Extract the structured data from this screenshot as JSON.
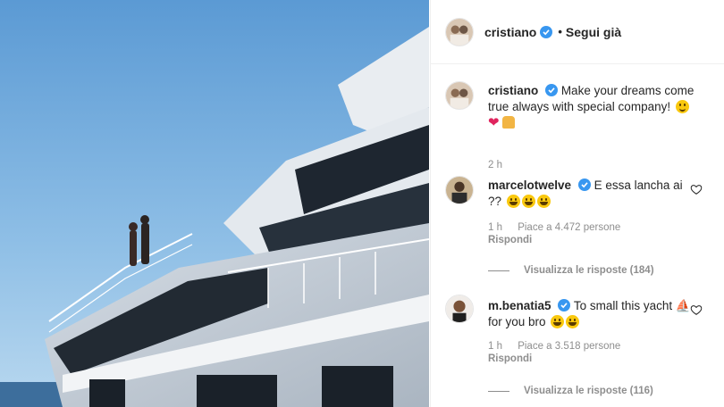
{
  "post": {
    "author": "cristiano",
    "follow_status": "Segui già",
    "separator": "•"
  },
  "caption": {
    "user": "cristiano",
    "text": "Make your dreams come true always with special company!",
    "time": "2 h"
  },
  "comments": [
    {
      "user": "marcelotwelve",
      "text": "E essa lancha ai ??",
      "time": "1 h",
      "likes": "Piace a 4.472 persone",
      "reply": "Rispondi",
      "view_replies": "Visualizza le risposte (184)"
    },
    {
      "user": "m.benatia5",
      "text": "To small this yacht ⛵ for you bro",
      "time": "1 h",
      "likes": "Piace a 3.518 persone",
      "reply": "Rispondi",
      "view_replies": "Visualizza le risposte (116)"
    }
  ],
  "colors": {
    "verified": "#3897f0",
    "secondary_text": "#8e8e8e",
    "sky": "#7fb2dd",
    "heart_red": "#e0245e"
  },
  "icons": [
    "verified-badge-icon",
    "heart-outline-icon",
    "red-heart-emoji",
    "praying-hands-emoji",
    "smile-emoji",
    "laughing-emoji"
  ]
}
